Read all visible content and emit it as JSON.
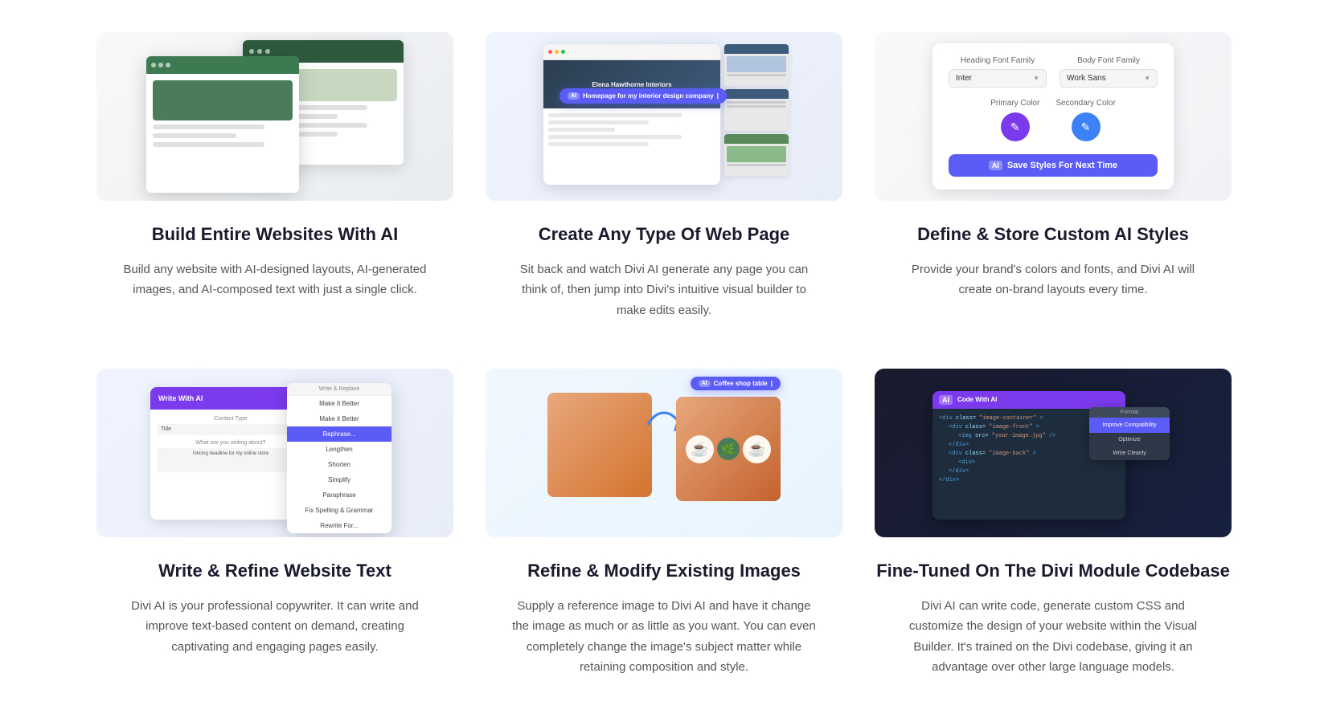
{
  "features": [
    {
      "id": "build-websites",
      "title": "Build Entire Websites With AI",
      "description": "Build any website with AI-designed layouts, AI-generated images, and AI-composed text with just a single click.",
      "image_alt": "AI website builder mockup"
    },
    {
      "id": "create-web-page",
      "title": "Create Any Type Of Web Page",
      "description": "Sit back and watch Divi AI generate any page you can think of, then jump into Divi's intuitive visual builder to make edits easily.",
      "image_alt": "Web page creation mockup",
      "ai_prompt": "Homepage for my interior design company"
    },
    {
      "id": "custom-ai-styles",
      "title": "Define & Store Custom AI Styles",
      "description": "Provide your brand's colors and fonts, and Divi AI will create on-brand layouts every time.",
      "image_alt": "Custom AI styles panel",
      "heading_font_label": "Heading Font Family",
      "body_font_label": "Body Font Family",
      "heading_font_value": "Inter",
      "body_font_value": "Work Sans",
      "primary_color_label": "Primary Color",
      "secondary_color_label": "Secondary Color",
      "save_button_label": "Save Styles For Next Time"
    },
    {
      "id": "write-refine",
      "title": "Write & Refine Website Text",
      "description": "Divi AI is your professional copywriter. It can write and improve text-based content on demand, creating captivating and engaging pages easily.",
      "image_alt": "Write and refine text mockup",
      "write_with_ai_label": "Write With AI",
      "content_type_label": "Content Type",
      "title_label": "Title",
      "about_label": "What are you writing about?",
      "about_value": "Inticing headline for my online store",
      "menu_header": "Write & Replace",
      "menu_items": [
        "Make It Better",
        "Make it Better",
        "Rephrase",
        "Lengthen",
        "Shorten",
        "Simplify",
        "Paraphrase",
        "Fix Spelling & Grammar",
        "Rewrite For..."
      ]
    },
    {
      "id": "refine-images",
      "title": "Refine & Modify Existing Images",
      "description": "Supply a reference image to Divi AI and have it change the image as much or as little as you want. You can even completely change the image's subject matter while retaining composition and style.",
      "image_alt": "Image modification mockup",
      "ai_prompt": "Coffee shop table"
    },
    {
      "id": "codebase",
      "title": "Fine-Tuned On The Divi Module Codebase",
      "description": "Divi AI can write code, generate custom CSS and customize the design of your website within the Visual Builder. It's trained on the Divi codebase, giving it an advantage over other large language models.",
      "image_alt": "Code editor mockup",
      "code_with_ai_label": "Code With AI",
      "format_header": "Format",
      "format_items": [
        "Improve Compatibility",
        "Optimize",
        "Write Cleanly"
      ]
    }
  ]
}
